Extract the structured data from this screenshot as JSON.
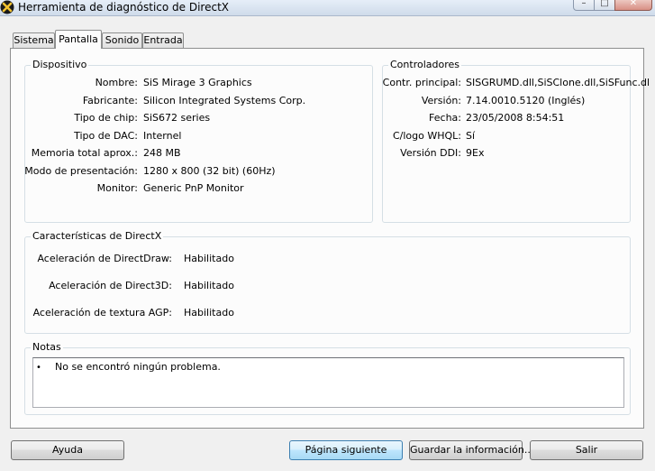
{
  "window": {
    "title": "Herramienta de diagnóstico de DirectX"
  },
  "tabs": [
    {
      "label": "Sistema"
    },
    {
      "label": "Pantalla"
    },
    {
      "label": "Sonido"
    },
    {
      "label": "Entrada"
    }
  ],
  "device": {
    "legend": "Dispositivo",
    "rows": [
      {
        "label": "Nombre:",
        "value": "SiS Mirage 3 Graphics"
      },
      {
        "label": "Fabricante:",
        "value": "Silicon Integrated Systems Corp."
      },
      {
        "label": "Tipo de chip:",
        "value": "SiS672 series"
      },
      {
        "label": "Tipo de DAC:",
        "value": "Internel"
      },
      {
        "label": "Memoria total aprox.:",
        "value": "248 MB"
      },
      {
        "label": "Modo de presentación:",
        "value": "1280 x 800 (32 bit) (60Hz)"
      },
      {
        "label": "Monitor:",
        "value": "Generic PnP Monitor"
      }
    ]
  },
  "drivers": {
    "legend": "Controladores",
    "rows": [
      {
        "label": "Contr. principal:",
        "value": "SISGRUMD.dll,SiSClone.dll,SiSFunc.dl"
      },
      {
        "label": "Versión:",
        "value": "7.14.0010.5120 (Inglés)"
      },
      {
        "label": "Fecha:",
        "value": "23/05/2008 8:54:51"
      },
      {
        "label": "C/logo WHQL:",
        "value": "Sí"
      },
      {
        "label": "Versión DDI:",
        "value": "9Ex"
      }
    ]
  },
  "features": {
    "legend": "Características de DirectX",
    "rows": [
      {
        "label": "Aceleración de DirectDraw:",
        "value": "Habilitado"
      },
      {
        "label": "Aceleración de Direct3D:",
        "value": "Habilitado"
      },
      {
        "label": "Aceleración de textura AGP:",
        "value": "Habilitado"
      }
    ]
  },
  "notes": {
    "legend": "Notas",
    "bullet": "•",
    "text": "No se encontró ningún problema."
  },
  "buttons": {
    "help": "Ayuda",
    "next": "Página siguiente",
    "save": "Guardar la información...",
    "exit": "Salir"
  }
}
